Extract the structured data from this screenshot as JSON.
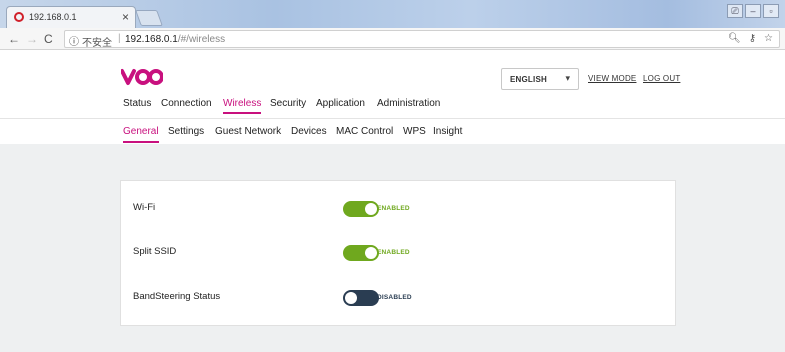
{
  "browser": {
    "tab_title": "192.168.0.1",
    "tab_close": "×",
    "security_label": "不安全",
    "url_host": "192.168.0.1",
    "url_path": "/#/wireless"
  },
  "header": {
    "language": "ENGLISH",
    "view_mode": "VIEW MODE",
    "log_out": "LOG OUT"
  },
  "main_nav": {
    "items": [
      {
        "label": "Status"
      },
      {
        "label": "Connection"
      },
      {
        "label": "Wireless",
        "active": true
      },
      {
        "label": "Security"
      },
      {
        "label": "Application"
      },
      {
        "label": "Administration"
      }
    ]
  },
  "sub_nav": {
    "items": [
      {
        "label": "General",
        "active": true
      },
      {
        "label": "Settings"
      },
      {
        "label": "Guest Network"
      },
      {
        "label": "Devices"
      },
      {
        "label": "MAC Control"
      },
      {
        "label": "WPS"
      },
      {
        "label": "Insight"
      }
    ]
  },
  "settings": {
    "rows": [
      {
        "label": "Wi-Fi",
        "state": "ENABLED",
        "on": true
      },
      {
        "label": "Split SSID",
        "state": "ENABLED",
        "on": true
      },
      {
        "label": "BandSteering Status",
        "state": "DISABLED",
        "on": false
      }
    ]
  },
  "colors": {
    "accent": "#c8107e",
    "toggle_on": "#6fa81e",
    "toggle_off": "#2a3d52",
    "logo": "#c8107e"
  },
  "icons": {
    "logo": "voo-logo",
    "favicon": "opera-icon",
    "back": "back-arrow-icon",
    "forward": "forward-arrow-icon",
    "reload": "reload-icon",
    "info": "info-icon",
    "zoom": "zoom-icon",
    "key": "key-icon",
    "star": "star-icon"
  }
}
